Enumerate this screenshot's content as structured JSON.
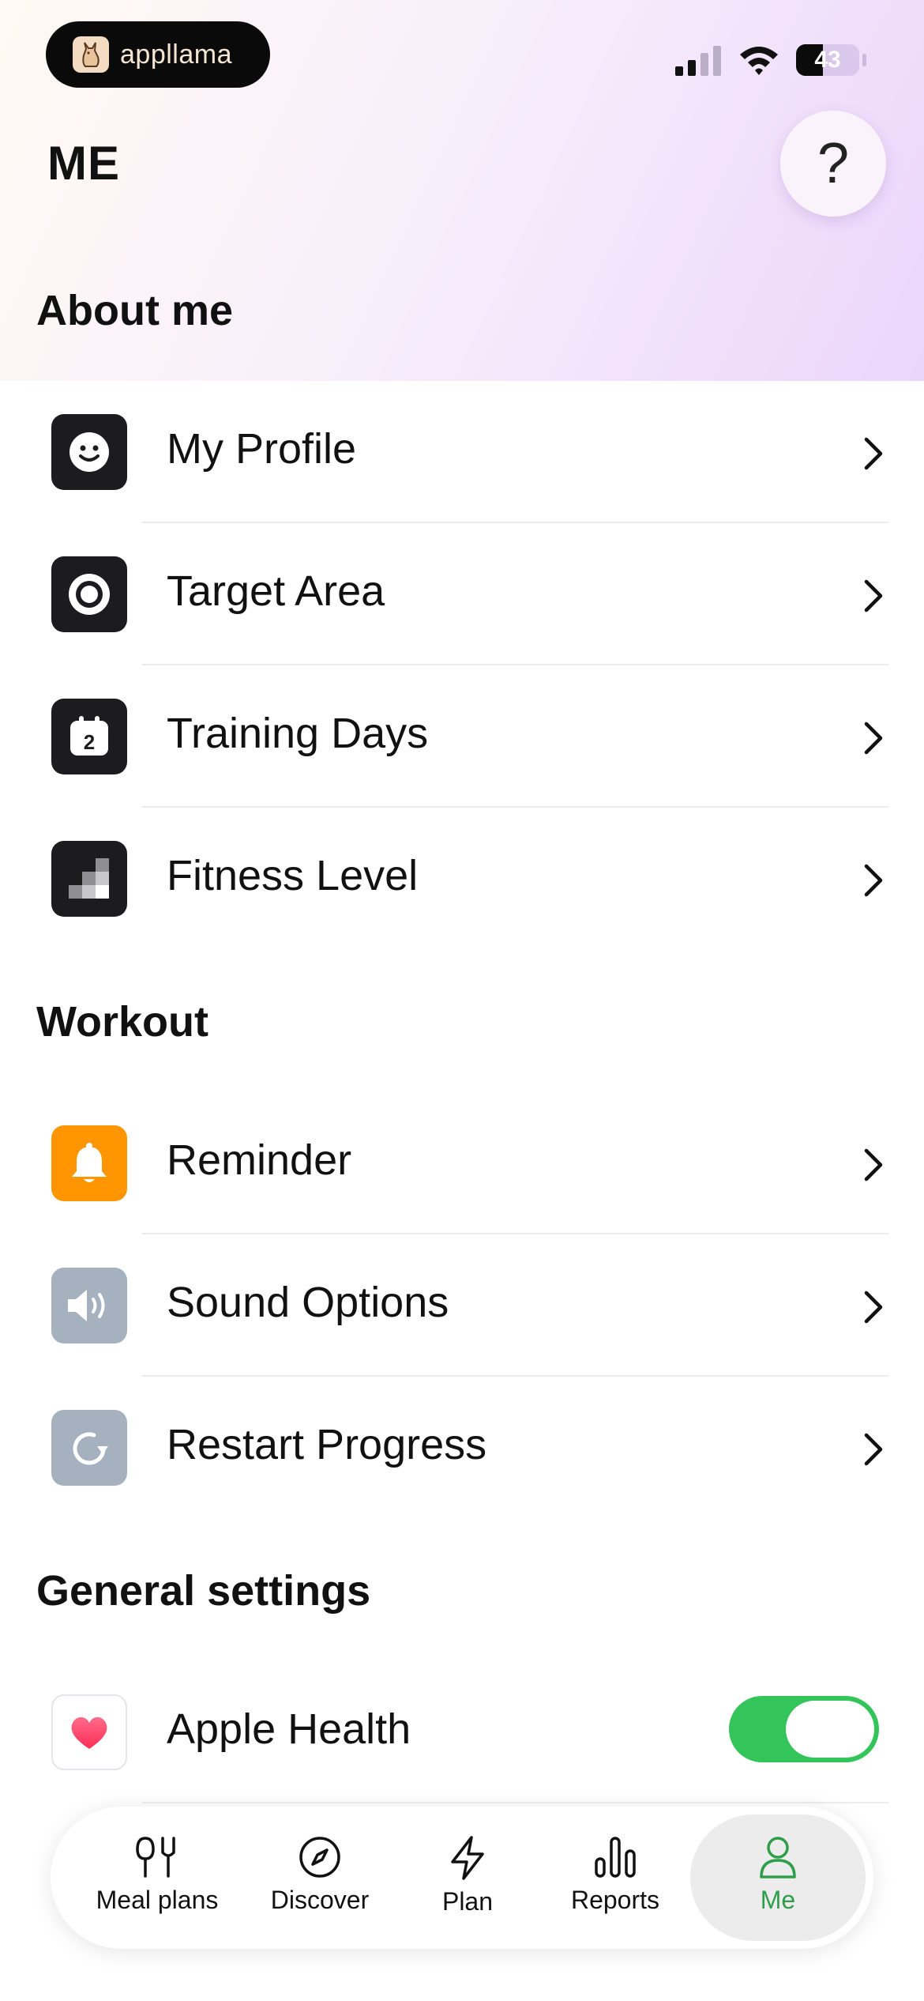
{
  "status_bar": {
    "app_pill": "appllama",
    "battery": "43",
    "battery_level": 0.43
  },
  "header": {
    "title": "ME",
    "help_icon": "?"
  },
  "sections": {
    "about_me": "About me",
    "workout": "Workout",
    "general": "General settings"
  },
  "rows": {
    "my_profile": "My Profile",
    "target_area": "Target Area",
    "training_days": "Training Days",
    "training_days_badge": "2",
    "fitness_level": "Fitness Level",
    "reminder": "Reminder",
    "sound_options": "Sound Options",
    "restart_progress": "Restart Progress",
    "apple_health": "Apple Health"
  },
  "apple_health_enabled": true,
  "tabs": [
    {
      "label": "Meal plans",
      "icon": "meal-plans-icon"
    },
    {
      "label": "Discover",
      "icon": "compass-icon"
    },
    {
      "label": "Plan",
      "icon": "lightning-icon"
    },
    {
      "label": "Reports",
      "icon": "bar-chart-icon"
    },
    {
      "label": "Me",
      "icon": "person-icon",
      "active": true
    }
  ],
  "colors": {
    "accent_green": "#34c55a",
    "active_tab": "#2e9e4a",
    "reminder_orange": "#ff9500",
    "muted_icon": "#a6b1bf",
    "dark_icon": "#1c1c1e"
  }
}
